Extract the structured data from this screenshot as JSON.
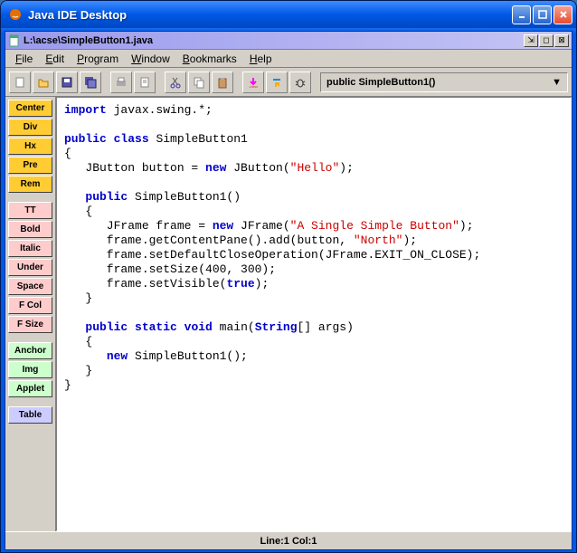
{
  "window": {
    "title": "Java IDE Desktop"
  },
  "mdi": {
    "filepath": "L:\\acse\\SimpleButton1.java"
  },
  "menu": {
    "file": "File",
    "edit": "Edit",
    "program": "Program",
    "window": "Window",
    "bookmarks": "Bookmarks",
    "help": "Help"
  },
  "dropdown": {
    "selected": "public SimpleButton1()"
  },
  "sidebar": {
    "center": "Center",
    "div": "Div",
    "hx": "Hx",
    "pre": "Pre",
    "rem": "Rem",
    "tt": "TT",
    "bold": "Bold",
    "italic": "Italic",
    "under": "Under",
    "space": "Space",
    "fcol": "F Col",
    "fsize": "F Size",
    "anchor": "Anchor",
    "img": "Img",
    "applet": "Applet",
    "table": "Table"
  },
  "code": {
    "l1a": "import",
    "l1b": " javax.swing.*;",
    "l2": "",
    "l3a": "public",
    "l3b": " ",
    "l3c": "class",
    "l3d": " SimpleButton1",
    "l4": "{",
    "l5a": "   JButton button = ",
    "l5b": "new",
    "l5c": " JButton(",
    "l5d": "\"Hello\"",
    "l5e": ");",
    "l6": "",
    "l7a": "   ",
    "l7b": "public",
    "l7c": " SimpleButton1()",
    "l8": "   {",
    "l9a": "      JFrame frame = ",
    "l9b": "new",
    "l9c": " JFrame(",
    "l9d": "\"A Single Simple Button\"",
    "l9e": ");",
    "l10a": "      frame.getContentPane().add(button, ",
    "l10b": "\"North\"",
    "l10c": ");",
    "l11": "      frame.setDefaultCloseOperation(JFrame.EXIT_ON_CLOSE);",
    "l12": "      frame.setSize(400, 300);",
    "l13a": "      frame.setVisible(",
    "l13b": "true",
    "l13c": ");",
    "l14": "   }",
    "l15": "",
    "l16a": "   ",
    "l16b": "public",
    "l16c": " ",
    "l16d": "static",
    "l16e": " ",
    "l16f": "void",
    "l16g": " main(",
    "l16h": "String",
    "l16i": "[] args)",
    "l17": "   {",
    "l18a": "      ",
    "l18b": "new",
    "l18c": " SimpleButton1();",
    "l19": "   }",
    "l20": "}"
  },
  "status": {
    "text": "Line:1  Col:1"
  }
}
